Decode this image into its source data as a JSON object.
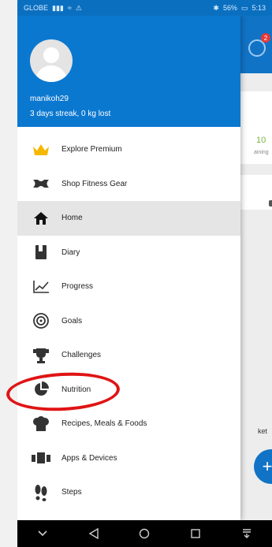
{
  "status_bar": {
    "carrier": "GLOBE",
    "battery": "56%",
    "time": "5:13"
  },
  "drawer": {
    "username": "manikoh29",
    "streak": "3 days streak, 0 kg lost",
    "items": [
      {
        "label": "Explore Premium",
        "icon": "crown-icon"
      },
      {
        "label": "Shop Fitness Gear",
        "icon": "under-armour-logo-icon"
      },
      {
        "label": "Home",
        "icon": "home-icon",
        "active": true
      },
      {
        "label": "Diary",
        "icon": "diary-book-icon"
      },
      {
        "label": "Progress",
        "icon": "line-chart-icon"
      },
      {
        "label": "Goals",
        "icon": "target-icon"
      },
      {
        "label": "Challenges",
        "icon": "trophy-icon"
      },
      {
        "label": "Nutrition",
        "icon": "pie-chart-icon"
      },
      {
        "label": "Recipes, Meals & Foods",
        "icon": "chef-hat-icon"
      },
      {
        "label": "Apps & Devices",
        "icon": "devices-icon"
      },
      {
        "label": "Steps",
        "icon": "footsteps-icon"
      }
    ]
  },
  "background_app": {
    "badge_count": "2",
    "value_green": "10",
    "small_text": "aining",
    "ket_text": "ket",
    "fab_label": "+",
    "q_text": "Q"
  },
  "colors": {
    "primary_blue": "#0b78d0",
    "highlight_red": "#e01414",
    "active_row": "#e5e5e5"
  }
}
